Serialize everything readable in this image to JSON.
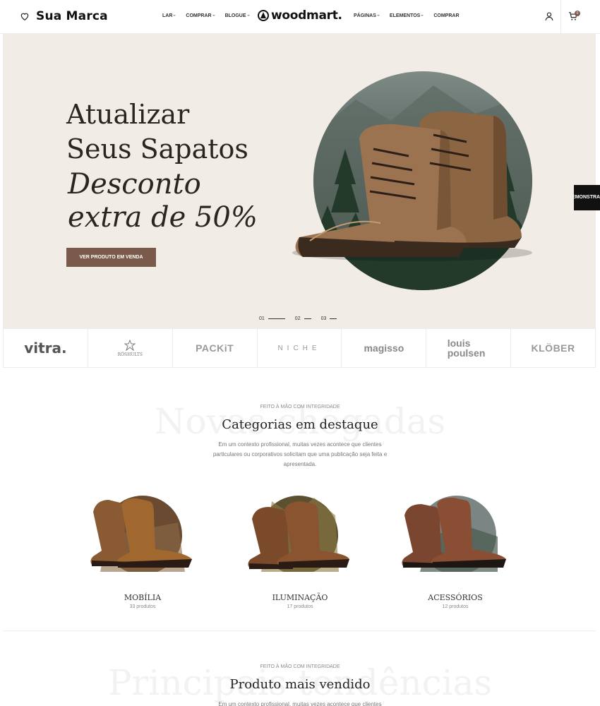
{
  "header": {
    "brand": "Sua Marca",
    "logo": "woodmart.",
    "nav_left": [
      {
        "label": "LAR",
        "has_dropdown": true
      },
      {
        "label": "COMPRAR",
        "has_dropdown": true
      },
      {
        "label": "BLOGUE",
        "has_dropdown": true
      }
    ],
    "nav_right": [
      {
        "label": "PÁGINAS",
        "has_dropdown": true
      },
      {
        "label": "ELEMENTOS",
        "has_dropdown": true
      },
      {
        "label": "COMPRAR",
        "has_dropdown": false
      }
    ],
    "icons": {
      "wishlist": "heart-icon",
      "account": "user-icon",
      "cart": "cart-icon"
    },
    "cart_count": "0"
  },
  "hero": {
    "line1": "Atualizar",
    "line2": "Seus Sapatos",
    "line3": "Desconto",
    "line4": "extra de 50%",
    "cta": "VER PRODUTO EM VENDA",
    "slides": [
      "01",
      "02",
      "03"
    ],
    "active_slide": "01"
  },
  "side_tab": {
    "label": "DEMONSTRAÇÕES"
  },
  "brands": [
    "vitra.",
    "RÖSHULTS",
    "PACKiT",
    "NICHE",
    "magisso",
    "louis poulsen",
    "KLÖBER"
  ],
  "featured": {
    "ghost": "Novas chegadas",
    "kicker": "FEITO À MÃO COM INTEGRIDADE",
    "title": "Categorias em destaque",
    "description": "Em um contexto profissional, muitas vezes acontece que clientes particulares ou corporativos solicitam que uma publicação seja feita e apresentada."
  },
  "categories": [
    {
      "name": "MOBÍLIA",
      "count": "33 produtos"
    },
    {
      "name": "ILUMINAÇÃO",
      "count": "17 produtos"
    },
    {
      "name": "ACESSÓRIOS",
      "count": "12 produtos"
    }
  ],
  "bestseller": {
    "ghost": "Principais tendências",
    "kicker": "FEITO À MÃO COM INTEGRIDADE",
    "title": "Produto mais vendido",
    "description": "Em um contexto profissional, muitas vezes acontece que clientes"
  },
  "colors": {
    "accent": "#7a5a4a",
    "hero_bg": "#f1ece6"
  }
}
